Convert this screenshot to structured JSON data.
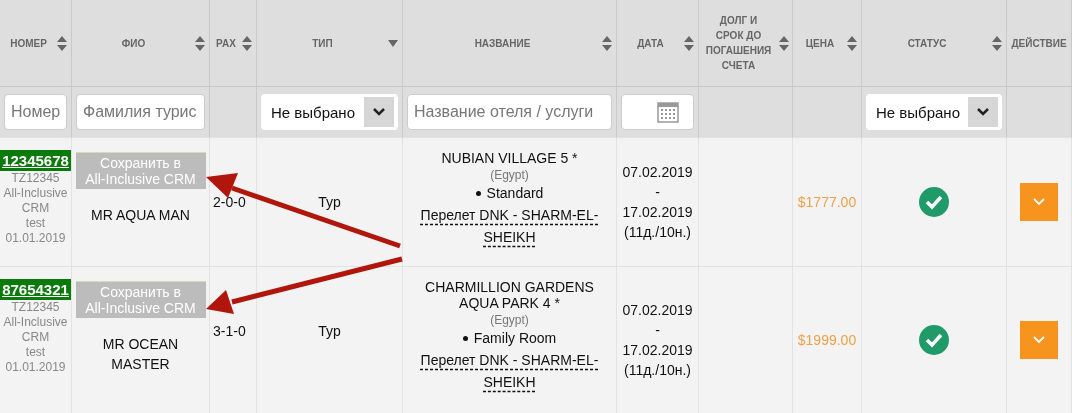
{
  "columns": [
    {
      "label": "НОМЕР",
      "kind": "sortable"
    },
    {
      "label": "ФИО",
      "kind": "sortable"
    },
    {
      "label": "PAX",
      "kind": "sortable"
    },
    {
      "label": "ТИП",
      "kind": "dropdown"
    },
    {
      "label": "НАЗВАНИЕ",
      "kind": "sortable"
    },
    {
      "label": "ДАТА",
      "kind": "sortable"
    },
    {
      "label": "ДОЛГ И СРОК ДО ПОГАШЕНИЯ СЧЕТА",
      "kind": "sortable"
    },
    {
      "label": "ЦЕНА",
      "kind": "sortable"
    },
    {
      "label": "СТАТУС",
      "kind": "sortable"
    },
    {
      "label": "ДЕЙСТВИЕ",
      "kind": "plain"
    }
  ],
  "filters": [
    {
      "kind": "input",
      "placeholder": "Номер"
    },
    {
      "kind": "input",
      "placeholder": "Фамилия турис"
    },
    {
      "kind": "none"
    },
    {
      "kind": "select",
      "value": "Не выбрано"
    },
    {
      "kind": "input",
      "placeholder": "Название отеля / услуги"
    },
    {
      "kind": "date"
    },
    {
      "kind": "none"
    },
    {
      "kind": "none"
    },
    {
      "kind": "select",
      "value": "Не выбрано"
    },
    {
      "kind": "none"
    }
  ],
  "rows": [
    {
      "number": "12345678",
      "meta": [
        "TZ12345",
        "All-Inclusive",
        "CRM",
        "test",
        "01.01.2019"
      ],
      "save_button": "Сохранить в\nAll-Inclusive CRM",
      "name": "MR AQUA MAN",
      "pax": "2-0-0",
      "type": "Тур",
      "hotel": "NUBIAN VILLAGE 5 *",
      "country": "(Egypt)",
      "room": "Standard",
      "flight": "Перелет DNK - SHARM-EL-SHEIKH",
      "dates": [
        "07.02.2019",
        "-",
        "17.02.2019",
        "(11д./10н.)"
      ],
      "price": "$1777.00",
      "confirmed": true
    },
    {
      "number": "87654321",
      "meta": [
        "TZ12345",
        "All-Inclusive",
        "CRM",
        "test",
        "01.01.2019"
      ],
      "save_button": "Сохранить в\nAll-Inclusive CRM",
      "name": "MR OCEAN MASTER",
      "pax": "3-1-0",
      "type": "Тур",
      "hotel": "CHARMILLION GARDENS AQUA PARK 4 *",
      "country": "(Egypt)",
      "room": "Family Room",
      "flight": "Перелет DNK - SHARM-EL-SHEIKH",
      "dates": [
        "07.02.2019",
        "-",
        "17.02.2019",
        "(11д./10н.)"
      ],
      "price": "$1999.00",
      "confirmed": true
    }
  ]
}
